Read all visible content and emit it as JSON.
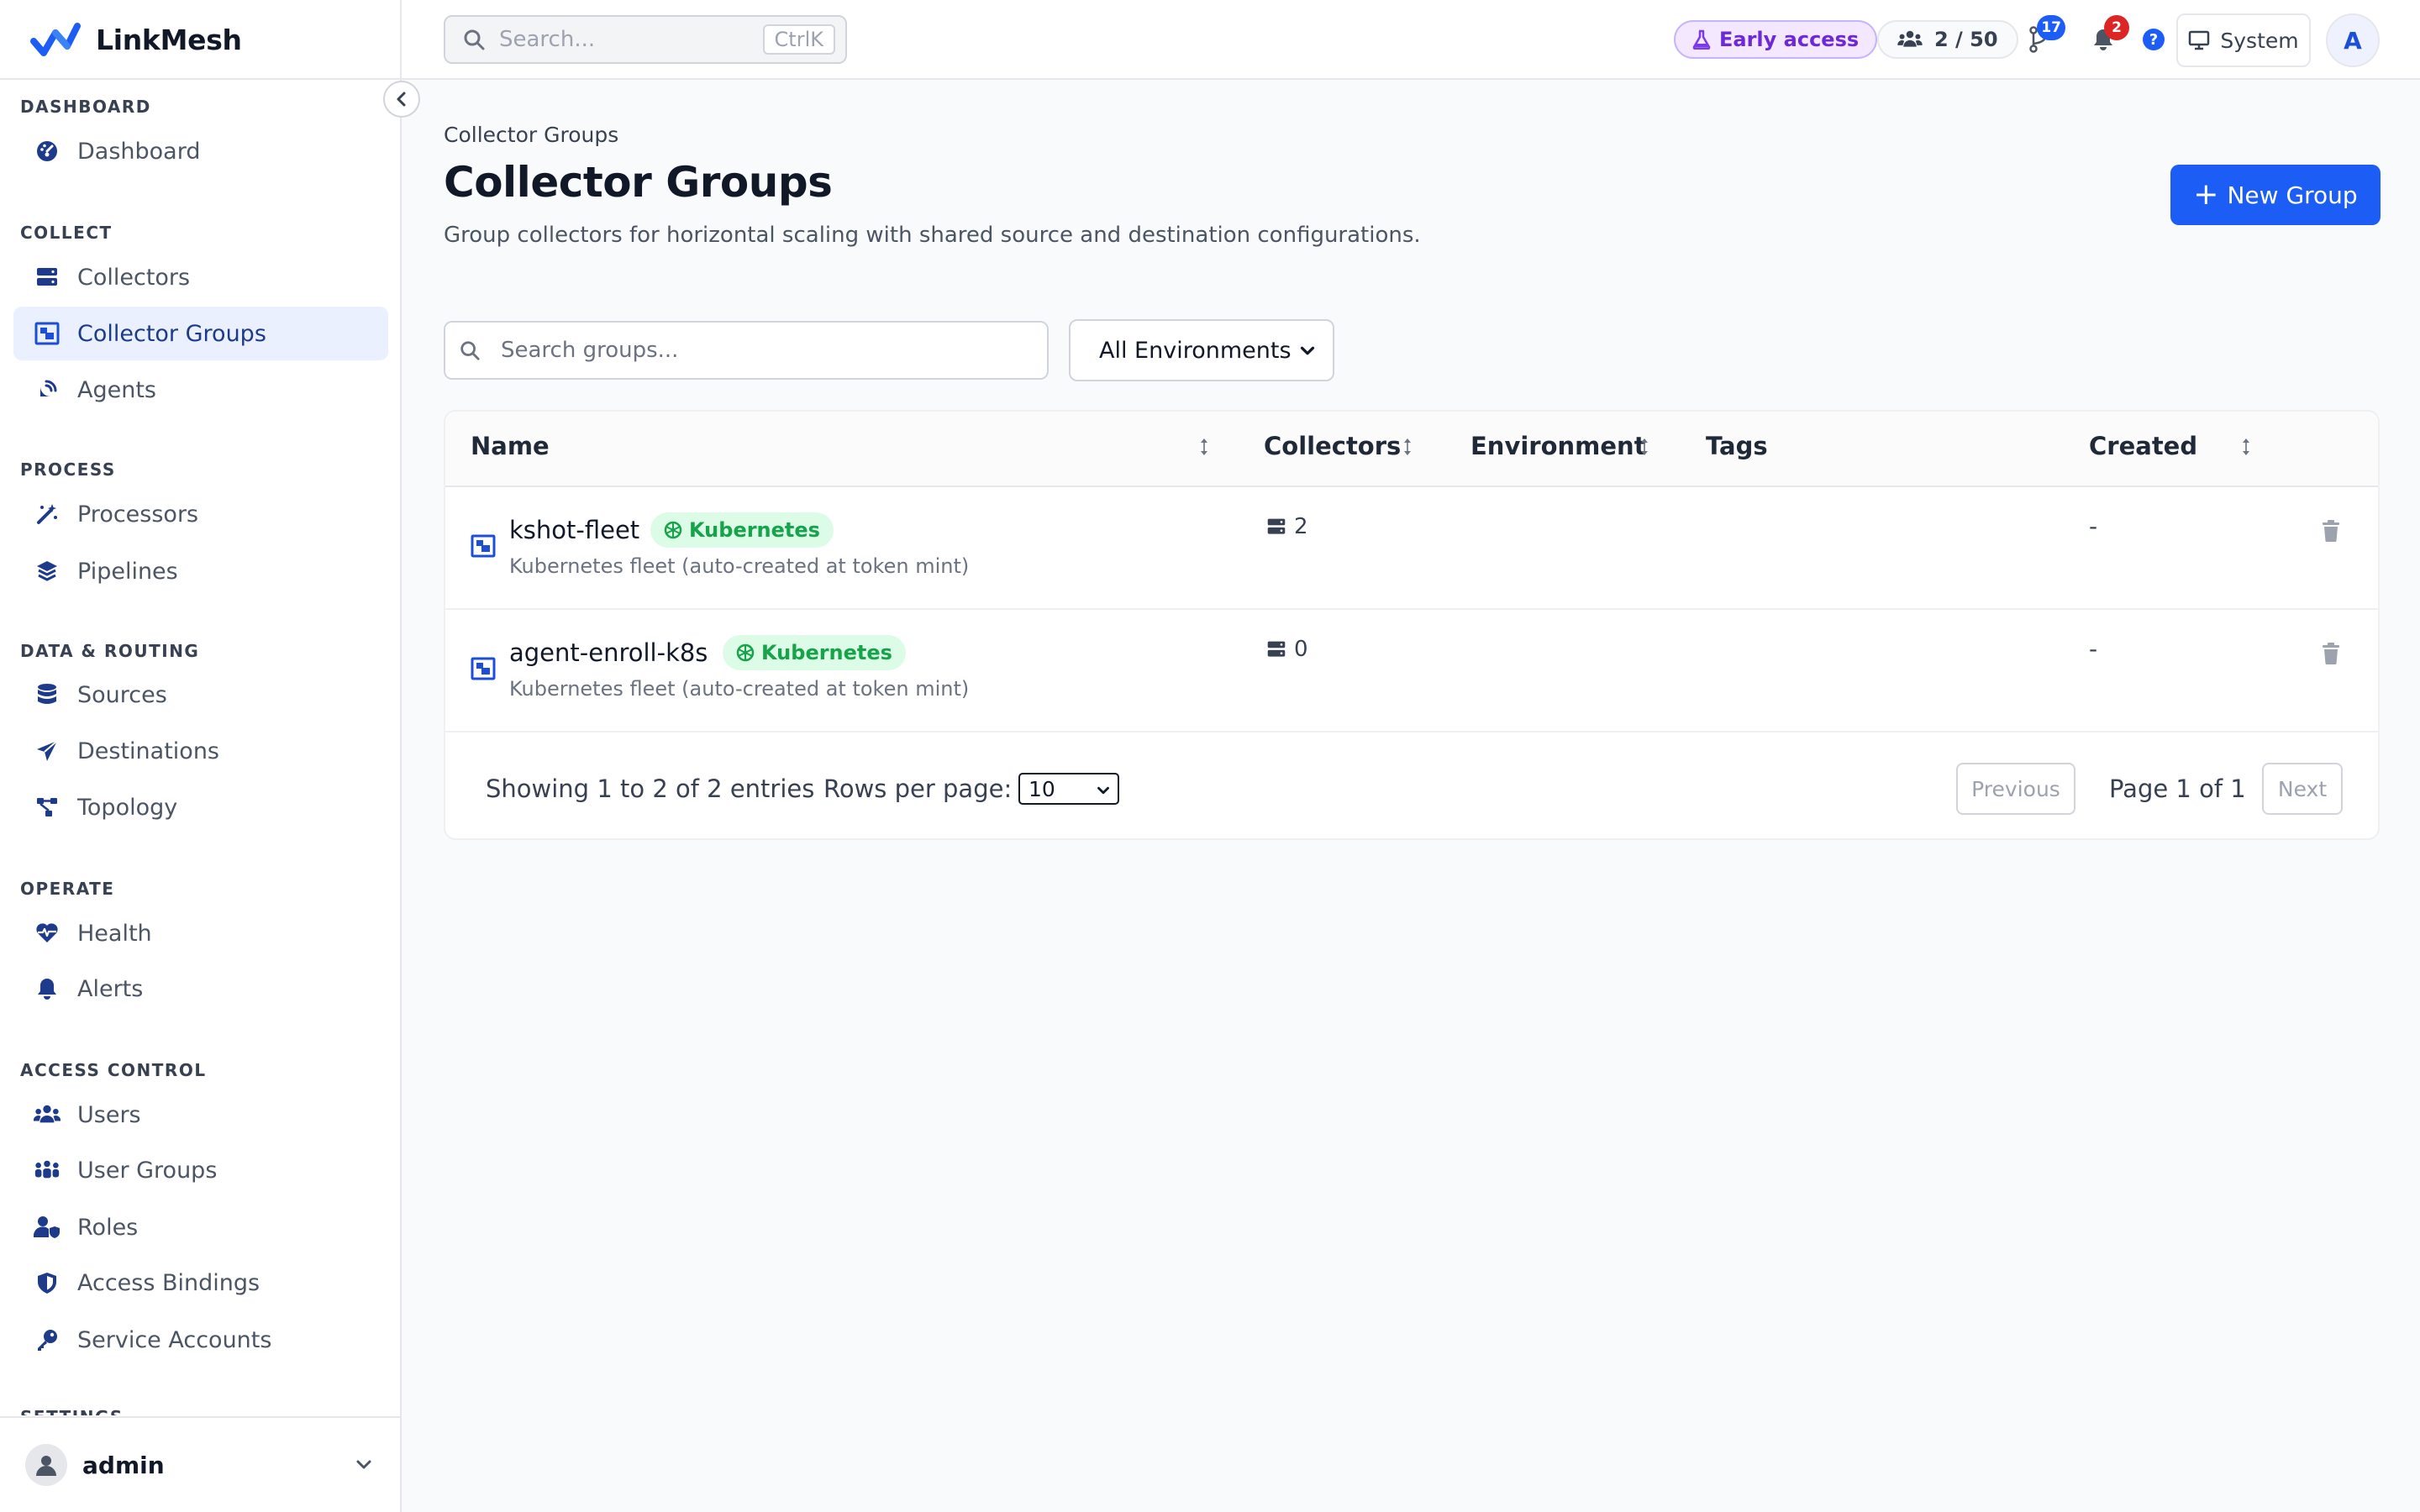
{
  "app": {
    "name": "LinkMesh",
    "brand_color": "#1c5df5"
  },
  "sidebar": {
    "sections": [
      {
        "title": "Dashboard",
        "items": [
          {
            "label": "Dashboard",
            "icon": "gauge-icon"
          }
        ]
      },
      {
        "title": "Collect",
        "items": [
          {
            "label": "Collectors",
            "icon": "server-icon"
          },
          {
            "label": "Collector Groups",
            "icon": "object-group-icon",
            "active": true
          },
          {
            "label": "Agents",
            "icon": "satellite-dish-icon"
          }
        ]
      },
      {
        "title": "Process",
        "items": [
          {
            "label": "Processors",
            "icon": "wand-icon"
          },
          {
            "label": "Pipelines",
            "icon": "layers-icon"
          }
        ]
      },
      {
        "title": "Data & Routing",
        "items": [
          {
            "label": "Sources",
            "icon": "database-icon"
          },
          {
            "label": "Destinations",
            "icon": "paper-plane-icon"
          },
          {
            "label": "Topology",
            "icon": "topology-icon"
          }
        ]
      },
      {
        "title": "Operate",
        "items": [
          {
            "label": "Health",
            "icon": "heart-pulse-icon"
          },
          {
            "label": "Alerts",
            "icon": "bell-icon"
          }
        ]
      },
      {
        "title": "Access Control",
        "items": [
          {
            "label": "Users",
            "icon": "users-icon"
          },
          {
            "label": "User Groups",
            "icon": "people-group-icon"
          },
          {
            "label": "Roles",
            "icon": "user-shield-icon"
          },
          {
            "label": "Access Bindings",
            "icon": "shield-icon"
          },
          {
            "label": "Service Accounts",
            "icon": "key-icon"
          }
        ]
      },
      {
        "title": "Settings",
        "items": []
      }
    ],
    "user": {
      "name": "admin"
    }
  },
  "topbar": {
    "search_placeholder": "Search...",
    "search_shortcut": "CtrlK",
    "early_access": "Early access",
    "seats": "2 / 50",
    "git_badge": "17",
    "notif_badge": "2",
    "help_glyph": "?",
    "theme_label": "System",
    "avatar_initial": "A"
  },
  "page": {
    "breadcrumb": "Collector Groups",
    "title": "Collector Groups",
    "subtitle": "Group collectors for horizontal scaling with shared source and destination configurations.",
    "new_button": "New Group",
    "new_button_glyph": "+",
    "group_search_placeholder": "Search groups...",
    "env_filter": "All Environments"
  },
  "table": {
    "columns": {
      "name": "Name",
      "collectors": "Collectors",
      "environment": "Environment",
      "tags": "Tags",
      "created": "Created"
    },
    "rows": [
      {
        "name": "kshot-fleet",
        "tag": "Kubernetes",
        "description": "Kubernetes fleet (auto-created at token mint)",
        "collectors": "2",
        "environment": "",
        "tags": "",
        "created": "-"
      },
      {
        "name": "agent-enroll-k8s",
        "tag": "Kubernetes",
        "description": "Kubernetes fleet (auto-created at token mint)",
        "collectors": "0",
        "environment": "",
        "tags": "",
        "created": "-"
      }
    ]
  },
  "pagination": {
    "showing": "Showing 1 to 2 of 2 entries",
    "rows_per_page_label": "Rows per page:",
    "rows_per_page": "10",
    "previous": "Previous",
    "page_info": "Page 1 of 1",
    "next": "Next"
  }
}
